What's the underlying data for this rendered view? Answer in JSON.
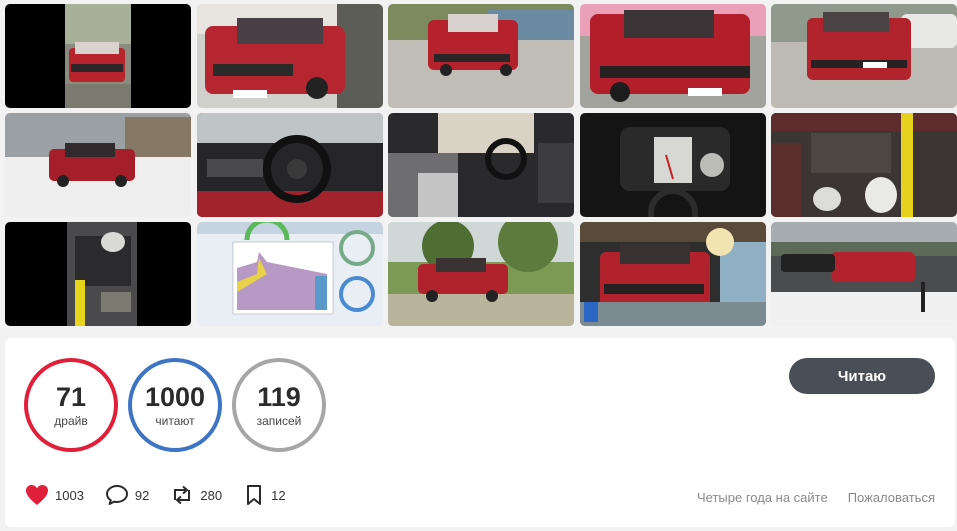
{
  "gallery": {
    "photos": [
      "red-car-front-black-frame",
      "red-car-front-left",
      "red-car-yard-front",
      "red-car-front-close",
      "red-car-rear",
      "red-car-snow",
      "dashboard-steering-wheel",
      "interior-gear-shifter",
      "instrument-cluster",
      "engine-bay",
      "engine-yellow-pipe",
      "gauge-chart-screen",
      "red-car-park",
      "red-car-garage",
      "red-car-winter-lot"
    ]
  },
  "stats": {
    "drive": {
      "value": "71",
      "label": "драйв"
    },
    "readers": {
      "value": "1000",
      "label": "читают"
    },
    "posts": {
      "value": "119",
      "label": "записей"
    }
  },
  "follow_button": {
    "label": "Читаю"
  },
  "actions": {
    "likes": "1003",
    "comments": "92",
    "reposts": "280",
    "bookmarks": "12"
  },
  "meta": {
    "years": "Четыре года на сайте",
    "report": "Пожаловаться"
  },
  "colors": {
    "drive_ring": "#e0203a",
    "readers_ring": "#3d74c4",
    "posts_ring": "#a6a6a6",
    "button_bg": "#4a4f57",
    "heart": "#e0203a"
  }
}
